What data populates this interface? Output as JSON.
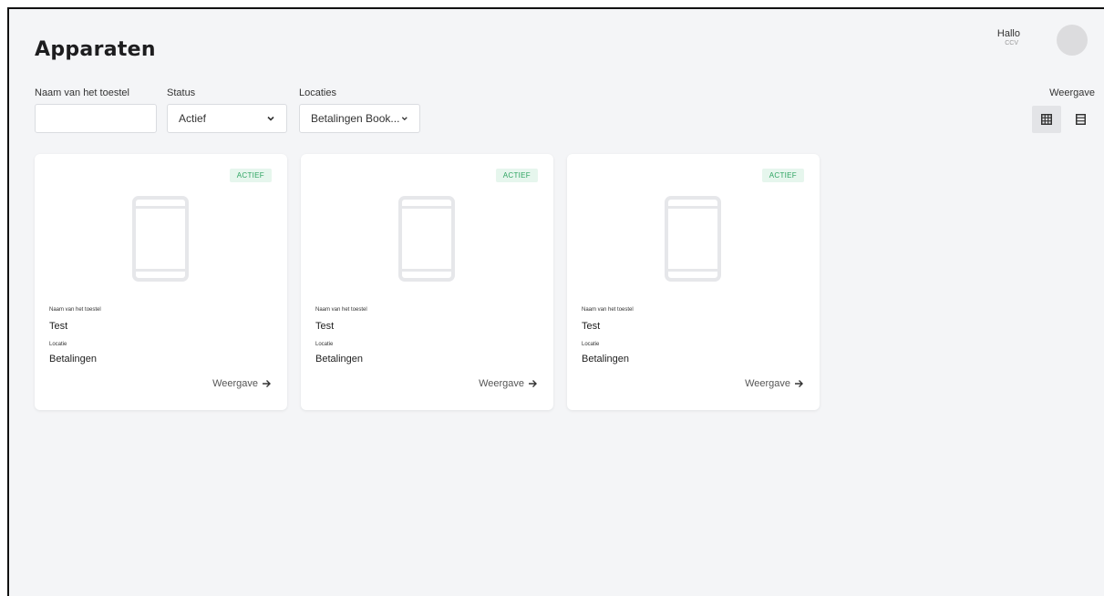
{
  "header": {
    "title": "Apparaten",
    "greeting": "Hallo",
    "user": "CCV"
  },
  "filters": {
    "name": {
      "label": "Naam van het toestel",
      "value": "",
      "placeholder": ""
    },
    "status": {
      "label": "Status",
      "selected": "Actief"
    },
    "location": {
      "label": "Locaties",
      "selected": "Betalingen Book..."
    }
  },
  "view": {
    "label": "Weergave",
    "active": "grid"
  },
  "cards": [
    {
      "status": "ACTIEF",
      "name_label": "Naam van het toestel",
      "name": "Test",
      "location_label": "Locatie",
      "location": "Betalingen",
      "link": "Weergave"
    },
    {
      "status": "ACTIEF",
      "name_label": "Naam van het toestel",
      "name": "Test",
      "location_label": "Locatie",
      "location": "Betalingen",
      "link": "Weergave"
    },
    {
      "status": "ACTIEF",
      "name_label": "Naam van het toestel",
      "name": "Test",
      "location_label": "Locatie",
      "location": "Betalingen",
      "link": "Weergave"
    }
  ],
  "colors": {
    "status_text": "#2fa462",
    "status_bg": "#e6f6ed",
    "background": "#f4f5f7"
  },
  "icons": {
    "status_select": "chevron-down-icon",
    "location_select": "chevron-down-icon",
    "grid_view": "grid-view-icon",
    "list_view": "list-view-icon",
    "device": "tablet-device-icon",
    "link": "arrow-right-icon"
  }
}
